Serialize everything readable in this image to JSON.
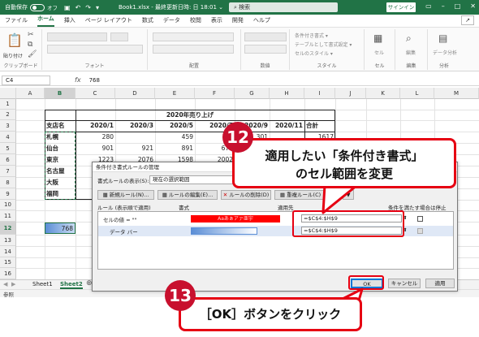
{
  "titlebar": {
    "autosave": "自動保存",
    "toggle_state": "オフ",
    "title": "Book1.xlsx - 最終更新日時: 日 18:01",
    "title_arrow": "⌄",
    "search_placeholder": "検索",
    "signin": "サインイン",
    "save_icon": "save-icon",
    "undo_icon": "undo-icon",
    "redo_icon": "redo-icon",
    "qat_more": "▾",
    "search_glyph": "⌕"
  },
  "ribbon_tabs": [
    "ファイル",
    "ホーム",
    "挿入",
    "ページ レイアウト",
    "数式",
    "データ",
    "校閲",
    "表示",
    "開発",
    "ヘルプ"
  ],
  "active_tab": "ホーム",
  "share_label": "↗",
  "ribbon": {
    "groups": [
      "クリップボード",
      "フォント",
      "配置",
      "数値",
      "スタイル",
      "セル",
      "編集",
      "分析"
    ],
    "paste": "貼り付け",
    "style_items": [
      "条件付き書式 ▾",
      "テーブルとして書式設定 ▾",
      "セルのスタイル ▾"
    ],
    "cells": "セル",
    "edit": "編集",
    "analyze": "データ分析",
    "font_name": "",
    "font_size": "",
    "number_format": ""
  },
  "formula_bar": {
    "name_box": "C4",
    "fx": "fx",
    "value": "768"
  },
  "columns": [
    "A",
    "B",
    "C",
    "D",
    "E",
    "F",
    "G",
    "H",
    "I",
    "J",
    "K",
    "L",
    "M"
  ],
  "rows": [
    "1",
    "2",
    "3",
    "4",
    "5",
    "6",
    "7",
    "8",
    "9",
    "10",
    "11",
    "12",
    "13",
    "14",
    "15",
    "16",
    "17"
  ],
  "sheet": {
    "table_title": "2020年売り上げ",
    "header_label": "支店名",
    "months": [
      "2020/1",
      "2020/3",
      "2020/5",
      "2020/7",
      "2020/9",
      "2020/11"
    ],
    "total_header": "合計",
    "branches": [
      "札幌",
      "仙台",
      "東京",
      "名古屋",
      "大阪",
      "福岡"
    ],
    "values": {
      "r4": [
        "280",
        "",
        "459",
        "",
        "301",
        "",
        "1617"
      ],
      "r5": [
        "901",
        "921",
        "891",
        "678",
        "",
        "",
        ""
      ],
      "r6": [
        "1223",
        "2076",
        "1598",
        "2002",
        "",
        "",
        ""
      ]
    },
    "b12_value": "768"
  },
  "sheet_tabs": [
    "Sheet1",
    "Sheet2"
  ],
  "status_text": "参照",
  "dialog": {
    "title": "条件付き書式ルールの管理",
    "show_rules_label": "書式ルールの表示(S):",
    "show_rules_value": "現在の選択範囲",
    "new_rule": "新規ルール(N)...",
    "edit_rule": "ルールの編集(E)...",
    "delete_rule": "ルールの削除(D)",
    "duplicate_rule": "重複ルール(C)",
    "col_rule": "ルール (表示順で適用)",
    "col_format": "書式",
    "col_applies": "適用先",
    "col_stop": "条件を満たす場合は停止",
    "rules": [
      {
        "name": "セルの値 = \"\"",
        "format_preview": "Aaあぁアァ亜宇",
        "applies_to": "=$C$4:$H$9"
      },
      {
        "name": "データ バー",
        "format_preview": "",
        "applies_to": "=$C$4:$H$9"
      }
    ],
    "ok": "OK",
    "cancel": "キャンセル",
    "apply": "適用"
  },
  "annotations": {
    "step12": "12",
    "callout12_line1": "適用したい「条件付き書式」",
    "callout12_line2": "のセル範囲を変更",
    "step13": "13",
    "callout13": "［OK］ボタンをクリック"
  },
  "colors": {
    "excel_green": "#217346",
    "annotation_red": "#e60012",
    "badge_red": "#c8102e",
    "rule_red_fill": "#ff0000",
    "databar_blue": "#5b8ed6"
  }
}
